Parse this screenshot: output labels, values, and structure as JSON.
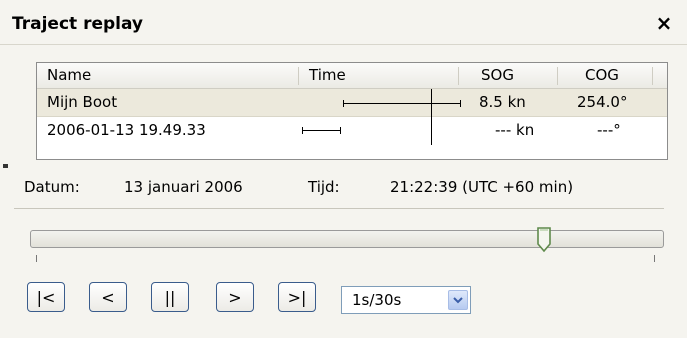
{
  "window": {
    "title": "Traject replay",
    "close_glyph": "×"
  },
  "table": {
    "columns": [
      "Name",
      "Time",
      "SOG",
      "COG"
    ],
    "rows": [
      {
        "name": "Mijn Boot",
        "sog": "8.5 kn",
        "cog": "254.0°"
      },
      {
        "name": "2006-01-13 19.49.33",
        "sog": "--- kn",
        "cog": "---°"
      }
    ]
  },
  "info": {
    "datum_label": "Datum:",
    "datum_value": "13 januari 2006",
    "tijd_label": "Tijd:",
    "tijd_value": "21:22:39 (UTC +60 min)"
  },
  "slider": {
    "position_fraction": 0.81
  },
  "controls": {
    "first_label": "|<",
    "prev_label": "<",
    "pause_label": "||",
    "next_label": ">",
    "last_label": ">|",
    "speed_value": "1s/30s"
  },
  "colors": {
    "accent": "#3a5c8c",
    "window_bg": "#f5f4ef",
    "selected_row": "#ece9dc"
  }
}
